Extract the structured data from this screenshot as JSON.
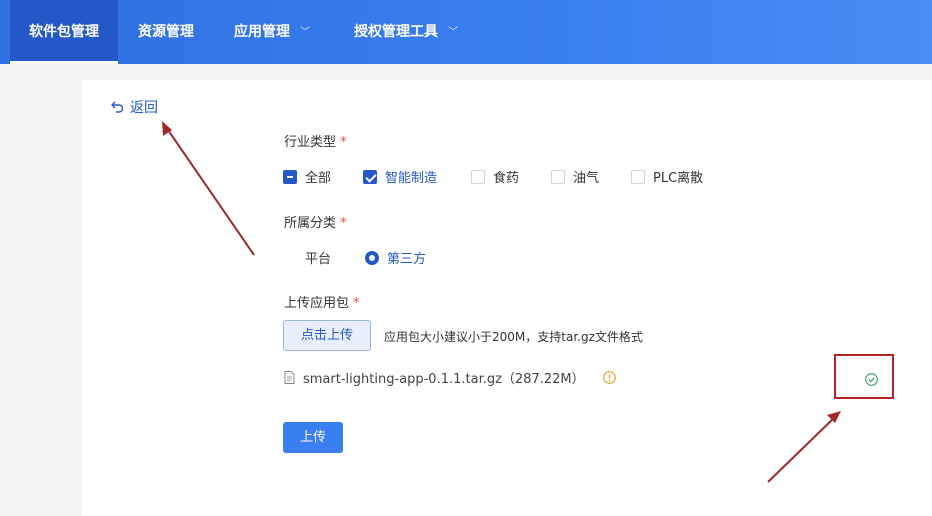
{
  "nav": {
    "items": [
      {
        "label": "软件包管理"
      },
      {
        "label": "资源管理"
      },
      {
        "label": "应用管理"
      },
      {
        "label": "授权管理工具"
      }
    ]
  },
  "back_label": "返回",
  "form": {
    "industry": {
      "label": "行业类型",
      "required_mark": "*",
      "options": [
        {
          "label": "全部",
          "state": "indeterminate"
        },
        {
          "label": "智能制造",
          "state": "checked"
        },
        {
          "label": "食药",
          "state": "unchecked"
        },
        {
          "label": "油气",
          "state": "unchecked"
        },
        {
          "label": "PLC离散",
          "state": "unchecked"
        }
      ]
    },
    "category": {
      "label": "所属分类",
      "required_mark": "*",
      "options": [
        {
          "label": "平台",
          "selected": false
        },
        {
          "label": "第三方",
          "selected": true
        }
      ]
    },
    "package": {
      "label": "上传应用包",
      "required_mark": "*",
      "upload_button": "点击上传",
      "hint": "应用包大小建议小于200M，支持tar.gz文件格式",
      "file_name": "smart-lighting-app-0.1.1.tar.gz（287.22M）"
    },
    "submit_label": "上传"
  },
  "colors": {
    "primary": "#2458c8",
    "nav_bg": "#3a7ff0",
    "required": "#e34d4d",
    "warning": "#e0a030",
    "success": "#3aa06a",
    "annotation": "#b32424"
  }
}
